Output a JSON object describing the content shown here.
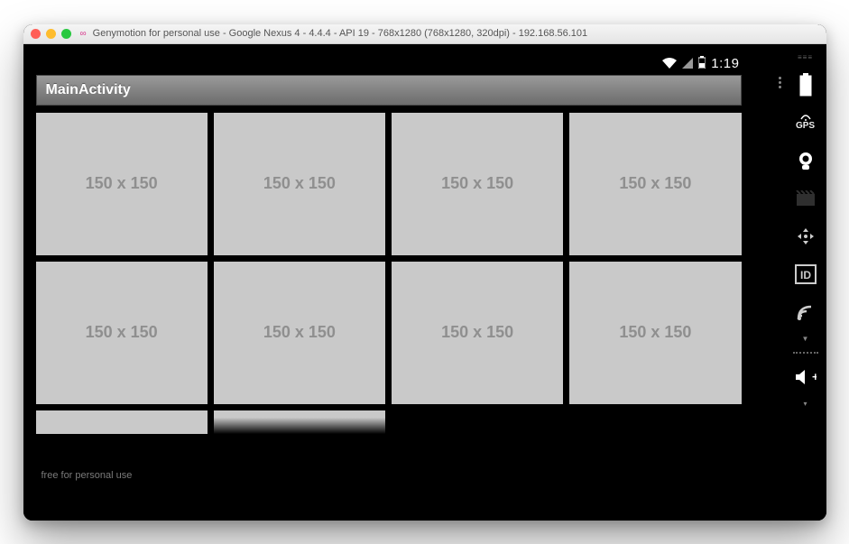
{
  "window": {
    "title": "Genymotion for personal use - Google Nexus 4 - 4.4.4 - API 19 - 768x1280 (768x1280, 320dpi) - 192.168.56.101"
  },
  "statusbar": {
    "time": "1:19"
  },
  "actionbar": {
    "title": "MainActivity"
  },
  "grid": {
    "placeholder_label": "150 x 150",
    "watermark": "free for personal use"
  },
  "sidebar_icons": {
    "battery": "battery-icon",
    "gps": "GPS",
    "camera": "camera-icon",
    "clapper": "clapper-icon",
    "remote": "remote-icon",
    "id": "ID",
    "signal": "signal-icon",
    "volume": "volume-icon"
  }
}
